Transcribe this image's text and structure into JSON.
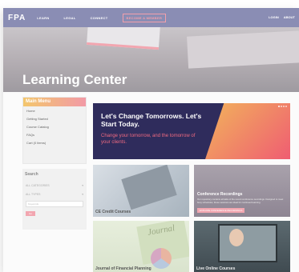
{
  "nav": {
    "logo": "FPA",
    "links": [
      "LEARN",
      "LEGAL",
      "CONNECT"
    ],
    "cta": "BECOME A MEMBER",
    "right": [
      "LOGIN",
      "ABOUT"
    ]
  },
  "hero": {
    "title": "Learning Center"
  },
  "sidebar": {
    "menu_title": "Main Menu",
    "menu_items": [
      "Home",
      "Getting Started",
      "Course Catalog",
      "FAQs",
      "Cart (0 items)"
    ],
    "search_title": "Search",
    "select1": "ALL CATEGORIES",
    "select2": "ALL TYPES",
    "search_placeholder": "Keywords",
    "go_label": "Go"
  },
  "banner": {
    "title": "Let's Change Tomorrows. Let's Start Today.",
    "subtitle": "Change your tomorrow, and the tomorrow of your clients."
  },
  "tiles": {
    "ce": "CE Credit Courses",
    "conf_title": "Conference Recordings",
    "conf_desc": "Our repository contains all talks of the recent conference recordings. Designed to meet busy schedules, these sessions are ideal for continued learning.",
    "conf_btn": "EXPLORE CONFERENCE RECORDINGS",
    "journal": "Journal of Financial Planning",
    "journal_cover": "Journal",
    "online": "Live Online Courses"
  },
  "colors": {
    "nav_bg": "#8a8db4",
    "accent_pink": "#f2a6b0",
    "banner_bg": "#2f2c5c",
    "banner_sub": "#ef6a80"
  }
}
